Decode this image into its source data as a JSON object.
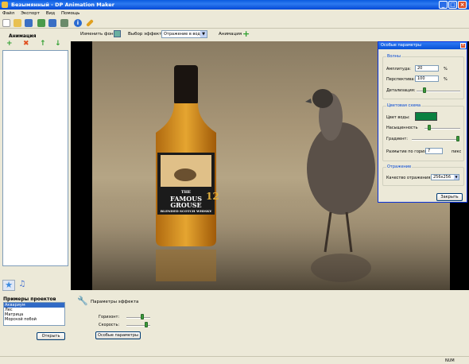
{
  "window": {
    "title": "Безымянный - DP Animation Maker"
  },
  "menu": [
    "Файл",
    "Экспорт",
    "Вид",
    "Помощь"
  ],
  "effect_bar": {
    "change_bg_label": "Изменить фон",
    "effect_select_label": "Выбор эффекта",
    "effect_value": "Отражение в воде",
    "animation_label": "Анимация"
  },
  "left_panel": {
    "title": "Анимация"
  },
  "samples": {
    "title": "Примеры проектов",
    "items": [
      "Аквариум",
      "Лес",
      "Матрица",
      "Морской побой"
    ],
    "open_label": "Открыть"
  },
  "image": {
    "bottle_brand_line1": "THE",
    "bottle_brand_line2": "FAMOUS",
    "bottle_brand_line3": "GROUSE",
    "bottle_age": "12",
    "bottle_sub": "BLENDED SCOTCH WHISKY"
  },
  "dialog": {
    "title": "Особые параметры",
    "waves": {
      "title": "Волны",
      "amplitude_label": "Амплитуда:",
      "amplitude_value": "20",
      "amplitude_unit": "%",
      "perspective_label": "Перспектива:",
      "perspective_value": "100",
      "perspective_unit": "%",
      "detail_label": "Детализация:",
      "detail_level": 0.15
    },
    "color": {
      "title": "Цветовая схема",
      "water_color_label": "Цвет воды:",
      "water_color": "#0a8040",
      "saturation_label": "Насыщенность",
      "saturation_level": 0.1,
      "gradient_label": "Градиент:",
      "gradient_level": 1.0,
      "blur_label": "Размытие по гориз.",
      "blur_value": "7",
      "blur_unit": "пикс"
    },
    "reflection": {
      "title": "Отражение",
      "quality_label": "Качество отражения:",
      "quality_value": "256x256"
    },
    "close_label": "Закрыть"
  },
  "bottom": {
    "effect_params_label": "Параметры эффекта",
    "horizon_label": "Горизонт:",
    "horizon_level": 0.7,
    "speed_label": "Скорость:",
    "speed_level": 0.9,
    "special_params_button": "Особые параметры"
  },
  "status": {
    "num": "NUM"
  }
}
